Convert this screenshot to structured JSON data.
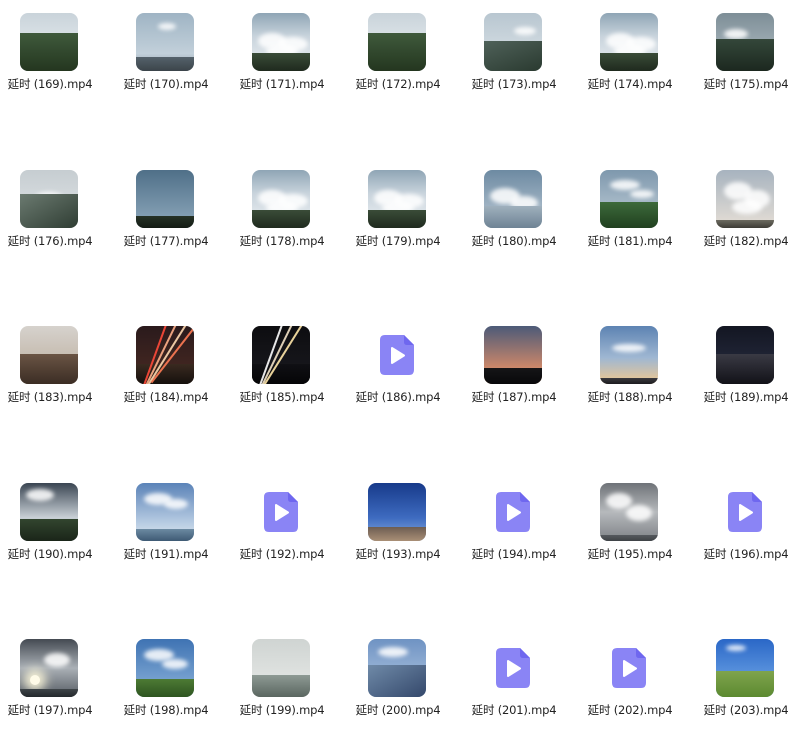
{
  "files": [
    {
      "name": "延时 (169).mp4",
      "thumb": "mountain-clouds",
      "has_thumbnail": true
    },
    {
      "name": "延时 (170).mp4",
      "thumb": "hazy-sky",
      "has_thumbnail": true
    },
    {
      "name": "延时 (171).mp4",
      "thumb": "cloud-sea",
      "has_thumbnail": true
    },
    {
      "name": "延时 (172).mp4",
      "thumb": "mountain-clouds",
      "has_thumbnail": true
    },
    {
      "name": "延时 (173).mp4",
      "thumb": "mountain-ridge",
      "has_thumbnail": true
    },
    {
      "name": "延时 (174).mp4",
      "thumb": "cloud-sea",
      "has_thumbnail": true
    },
    {
      "name": "延时 (175).mp4",
      "thumb": "mountain-dark",
      "has_thumbnail": true
    },
    {
      "name": "延时 (176).mp4",
      "thumb": "foggy-slope",
      "has_thumbnail": true
    },
    {
      "name": "延时 (177).mp4",
      "thumb": "blue-sky-treeline",
      "has_thumbnail": true
    },
    {
      "name": "延时 (178).mp4",
      "thumb": "cloud-sea",
      "has_thumbnail": true
    },
    {
      "name": "延时 (179).mp4",
      "thumb": "cloud-sea",
      "has_thumbnail": true
    },
    {
      "name": "延时 (180).mp4",
      "thumb": "cloud-sea-blue",
      "has_thumbnail": true
    },
    {
      "name": "延时 (181).mp4",
      "thumb": "mountain-green",
      "has_thumbnail": true
    },
    {
      "name": "延时 (182).mp4",
      "thumb": "fluffy-clouds",
      "has_thumbnail": true
    },
    {
      "name": "延时 (183).mp4",
      "thumb": "city-people",
      "has_thumbnail": true
    },
    {
      "name": "延时 (184).mp4",
      "thumb": "light-trails-red",
      "has_thumbnail": true
    },
    {
      "name": "延时 (185).mp4",
      "thumb": "light-trails-night",
      "has_thumbnail": true
    },
    {
      "name": "延时 (186).mp4",
      "thumb": "video-file-icon",
      "has_thumbnail": false
    },
    {
      "name": "延时 (187).mp4",
      "thumb": "sunset-silhouette",
      "has_thumbnail": true
    },
    {
      "name": "延时 (188).mp4",
      "thumb": "sunset-sky",
      "has_thumbnail": true
    },
    {
      "name": "延时 (189).mp4",
      "thumb": "city-night",
      "has_thumbnail": true
    },
    {
      "name": "延时 (190).mp4",
      "thumb": "storm-mountain",
      "has_thumbnail": true
    },
    {
      "name": "延时 (191).mp4",
      "thumb": "sea-clouds",
      "has_thumbnail": true
    },
    {
      "name": "延时 (192).mp4",
      "thumb": "video-file-icon",
      "has_thumbnail": false
    },
    {
      "name": "延时 (193).mp4",
      "thumb": "blue-coast",
      "has_thumbnail": true
    },
    {
      "name": "延时 (194).mp4",
      "thumb": "video-file-icon",
      "has_thumbnail": false
    },
    {
      "name": "延时 (195).mp4",
      "thumb": "grey-clouds",
      "has_thumbnail": true
    },
    {
      "name": "延时 (196).mp4",
      "thumb": "video-file-icon",
      "has_thumbnail": false
    },
    {
      "name": "延时 (197).mp4",
      "thumb": "sun-clouds",
      "has_thumbnail": true
    },
    {
      "name": "延时 (198).mp4",
      "thumb": "green-field-sky",
      "has_thumbnail": true
    },
    {
      "name": "延时 (199).mp4",
      "thumb": "misty-lake",
      "has_thumbnail": true
    },
    {
      "name": "延时 (200).mp4",
      "thumb": "blue-valley",
      "has_thumbnail": true
    },
    {
      "name": "延时 (201).mp4",
      "thumb": "video-file-icon",
      "has_thumbnail": false
    },
    {
      "name": "延时 (202).mp4",
      "thumb": "video-file-icon",
      "has_thumbnail": false
    },
    {
      "name": "延时 (203).mp4",
      "thumb": "grassland-blue-sky",
      "has_thumbnail": true
    }
  ],
  "colors": {
    "background": "#ffffff",
    "label_text": "#222222",
    "placeholder_icon": "#8a84f5",
    "placeholder_icon_dark": "#6f67ef"
  }
}
